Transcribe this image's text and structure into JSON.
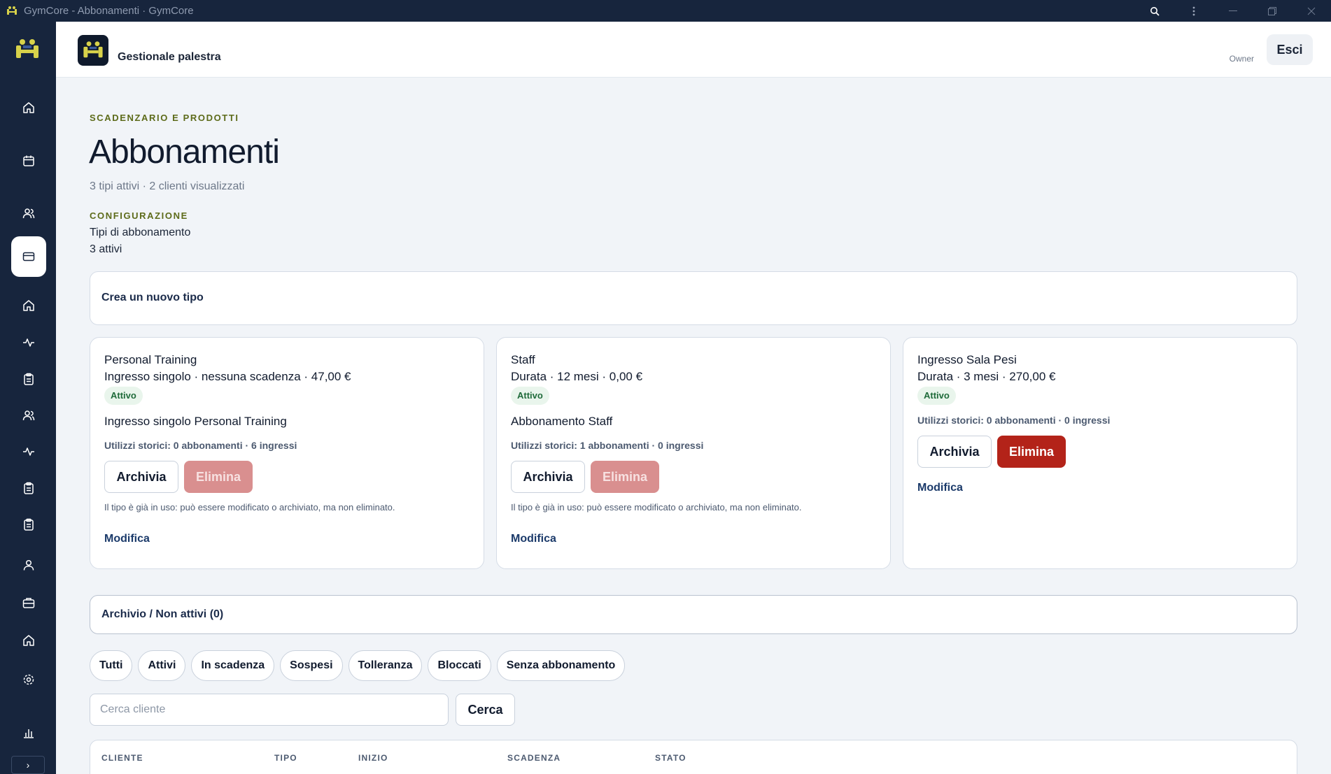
{
  "window": {
    "title": "GymCore - Abbonamenti · GymCore"
  },
  "header": {
    "brand_name": "Gestionale palestra",
    "role": "Owner",
    "logout_label": "Esci"
  },
  "sidebar": {
    "items": [
      {
        "icon": "home-icon",
        "active": false
      },
      {
        "icon": "calendar-icon",
        "active": false
      },
      {
        "icon": "users-icon",
        "active": false
      },
      {
        "icon": "card-icon",
        "active": true
      },
      {
        "icon": "home-icon",
        "active": false
      },
      {
        "icon": "activity-icon",
        "active": false
      },
      {
        "icon": "clipboard-icon",
        "active": false
      },
      {
        "icon": "users-icon",
        "active": false
      },
      {
        "icon": "activity-icon",
        "active": false
      },
      {
        "icon": "clipboard-icon",
        "active": false
      },
      {
        "icon": "clipboard-icon",
        "active": false
      },
      {
        "icon": "user-icon",
        "active": false
      },
      {
        "icon": "briefcase-icon",
        "active": false
      },
      {
        "icon": "home-icon",
        "active": false
      },
      {
        "icon": "gear-icon",
        "active": false
      },
      {
        "icon": "bar-chart-icon",
        "active": false
      }
    ],
    "expand_label": "›"
  },
  "page": {
    "eyebrow": "SCADENZARIO E PRODOTTI",
    "title": "Abbonamenti",
    "subtitle": "3 tipi attivi · 2 clienti visualizzati",
    "config_eyebrow": "CONFIGURAZIONE",
    "config_title": "Tipi di abbonamento",
    "config_count": "3 attivi",
    "create_label": "Crea un nuovo tipo",
    "archive_label": "Archivio / Non attivi (0)"
  },
  "cards": [
    {
      "name": "Personal Training",
      "meta": "Ingresso singolo · nessuna scadenza · 47,00 €",
      "status": "Attivo",
      "description": "Ingresso singolo Personal Training",
      "usage": "Utilizzi storici: 0 abbonamenti · 6 ingressi",
      "archive_label": "Archivia",
      "delete_label": "Elimina",
      "note": "Il tipo è già in uso: può essere modificato o archiviato, ma non eliminato.",
      "edit_label": "Modifica"
    },
    {
      "name": "Staff",
      "meta": "Durata · 12 mesi · 0,00 €",
      "status": "Attivo",
      "description": "Abbonamento Staff",
      "usage": "Utilizzi storici: 1 abbonamenti · 0 ingressi",
      "archive_label": "Archivia",
      "delete_label": "Elimina",
      "note": "Il tipo è già in uso: può essere modificato o archiviato, ma non eliminato.",
      "edit_label": "Modifica"
    },
    {
      "name": "Ingresso Sala Pesi",
      "meta": "Durata · 3 mesi · 270,00 €",
      "status": "Attivo",
      "usage": "Utilizzi storici: 0 abbonamenti · 0 ingressi",
      "archive_label": "Archivia",
      "delete_label": "Elimina",
      "edit_label": "Modifica"
    }
  ],
  "filters": [
    "Tutti",
    "Attivi",
    "In scadenza",
    "Sospesi",
    "Tolleranza",
    "Bloccati",
    "Senza abbonamento"
  ],
  "search": {
    "placeholder": "Cerca cliente",
    "button_label": "Cerca"
  },
  "table": {
    "columns": [
      "CLIENTE",
      "TIPO",
      "INIZIO",
      "SCADENZA",
      "STATO"
    ]
  },
  "colors": {
    "sidebar_bg": "#17253d",
    "accent_olive": "#5d6b1a",
    "danger": "#b32319",
    "danger_disabled": "#d98f8f",
    "badge_green": "#1f6b3a"
  }
}
